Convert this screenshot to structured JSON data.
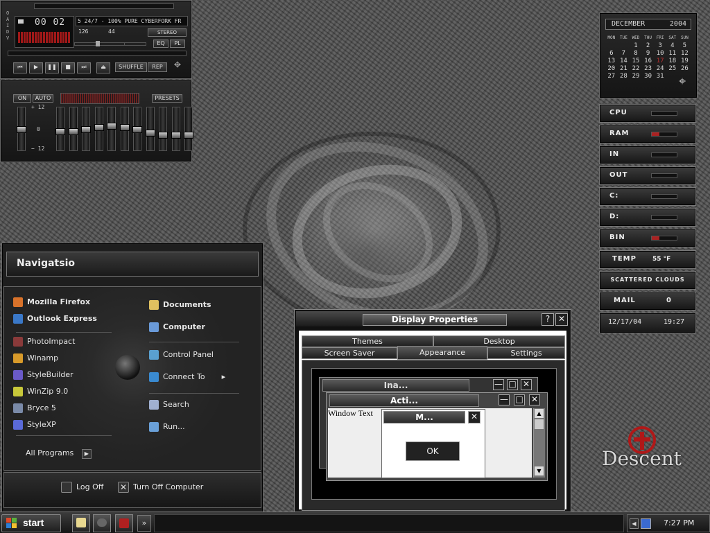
{
  "winamp": {
    "time": "00 02",
    "marquee": "5 24/7 - 100% PURE CYBERFORK FR",
    "kbps": "126",
    "khz": "44",
    "stereo": "STEREO",
    "eq_btn": "EQ",
    "pl_btn": "PL",
    "shuffle": "SHUFFLE",
    "rep": "REP",
    "side_letters": "O A I D V",
    "eq_on": "ON",
    "eq_auto": "AUTO",
    "presets": "PRESETS",
    "db_plus": "+ 12",
    "db_zero": "0",
    "db_minus": "− 12",
    "preamp_level": 0.5,
    "band_levels": [
      0.55,
      0.55,
      0.5,
      0.45,
      0.4,
      0.45,
      0.5,
      0.6,
      0.65,
      0.65,
      0.65
    ]
  },
  "calendar": {
    "month": "DECEMBER",
    "year": "2004",
    "weekdays": [
      "MON",
      "TUE",
      "WED",
      "THU",
      "FRI",
      "SAT",
      "SUN"
    ],
    "weeks": [
      [
        "",
        "",
        "1",
        "2",
        "3",
        "4",
        "5"
      ],
      [
        "6",
        "7",
        "8",
        "9",
        "10",
        "11",
        "12"
      ],
      [
        "13",
        "14",
        "15",
        "16",
        "17",
        "18",
        "19"
      ],
      [
        "20",
        "21",
        "22",
        "23",
        "24",
        "25",
        "26"
      ],
      [
        "27",
        "28",
        "29",
        "30",
        "31",
        "",
        ""
      ]
    ],
    "today": "17",
    "today_color": "#c03030"
  },
  "monitors": [
    {
      "label": "CPU",
      "fill": 0.0
    },
    {
      "label": "RAM",
      "fill": 0.3
    },
    {
      "label": "IN",
      "fill": 0.0
    },
    {
      "label": "OUT",
      "fill": 0.0
    },
    {
      "label": "C:",
      "fill": 0.0
    },
    {
      "label": "D:",
      "fill": 0.0
    },
    {
      "label": "BIN",
      "fill": 0.3
    }
  ],
  "weather": {
    "temp_label": "TEMP",
    "temp_value": "55 °F",
    "conditions": "SCATTERED CLOUDS"
  },
  "mail": {
    "label": "MAIL",
    "count": "0"
  },
  "datetime_widget": {
    "date": "12/17/04",
    "time": "19:27"
  },
  "logo": {
    "text": "Descent",
    "color": "#b01818"
  },
  "start_menu": {
    "user": "Navigatsio",
    "pinned": [
      {
        "label": "Mozilla Firefox",
        "icon": "firefox-icon",
        "color": "#d8722a"
      },
      {
        "label": "Outlook Express",
        "icon": "outlook-icon",
        "color": "#3a78c8"
      }
    ],
    "recent": [
      {
        "label": "PhotoImpact",
        "icon": "photoimpact-icon",
        "color": "#8a3a3a"
      },
      {
        "label": "Winamp",
        "icon": "winamp-icon",
        "color": "#d89a2a"
      },
      {
        "label": "StyleBuilder",
        "icon": "stylebuilder-icon",
        "color": "#6a5ac8"
      },
      {
        "label": "WinZip 9.0",
        "icon": "winzip-icon",
        "color": "#c8c83a"
      },
      {
        "label": "Bryce 5",
        "icon": "bryce-icon",
        "color": "#7a8aa8"
      },
      {
        "label": "StyleXP",
        "icon": "stylexp-icon",
        "color": "#5a6ad8"
      }
    ],
    "all_programs": "All Programs",
    "right": [
      {
        "label": "Documents",
        "icon": "documents-icon",
        "color": "#e0c060"
      },
      {
        "label": "Computer",
        "icon": "computer-icon",
        "color": "#6a9ad8"
      },
      {
        "label": "Control Panel",
        "icon": "control-panel-icon",
        "color": "#5aa0d0"
      },
      {
        "label": "Connect To",
        "icon": "connect-to-icon",
        "color": "#3a8ad0"
      },
      {
        "label": "Search",
        "icon": "search-icon",
        "color": "#a0b0d0"
      },
      {
        "label": "Run...",
        "icon": "run-icon",
        "color": "#6aa0d8"
      }
    ],
    "log_off": "Log Off",
    "turn_off": "Turn Off Computer"
  },
  "display_properties": {
    "title": "Display Properties",
    "help": "?",
    "close": "✕",
    "tabs_row1": [
      "Themes",
      "Desktop"
    ],
    "tabs_row2": [
      "Screen Saver",
      "Appearance",
      "Settings"
    ],
    "active_tab": "Appearance",
    "preview": {
      "inactive_title": "Ina...",
      "active_title": "Acti...",
      "window_text": "Window Text",
      "message_title": "M...",
      "ok": "OK"
    }
  },
  "taskbar": {
    "start": "start",
    "overflow": "»",
    "clock": "7:27 PM"
  }
}
